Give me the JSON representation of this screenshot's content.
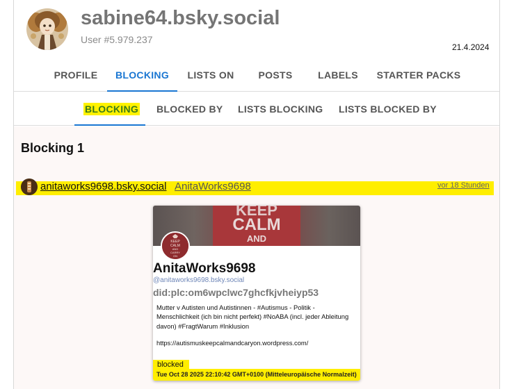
{
  "header": {
    "handle": "sabine64.bsky.social",
    "user_number": "User #5.979.237",
    "date": "21.4.2024"
  },
  "tabs": [
    {
      "label": "PROFILE",
      "active": false
    },
    {
      "label": "BLOCKING",
      "active": true
    },
    {
      "label": "LISTS ON",
      "active": false
    },
    {
      "label": "POSTS",
      "active": false
    },
    {
      "label": "LABELS",
      "active": false
    },
    {
      "label": "STARTER PACKS",
      "active": false
    }
  ],
  "subtabs": [
    {
      "label": "BLOCKING",
      "active": true
    },
    {
      "label": "BLOCKED BY",
      "active": false
    },
    {
      "label": "LISTS BLOCKING",
      "active": false
    },
    {
      "label": "LISTS BLOCKED BY",
      "active": false
    }
  ],
  "section": {
    "title": "Blocking 1"
  },
  "entry": {
    "handle": "anitaworks9698.bsky.social",
    "display_name": "AnitaWorks9698",
    "time_ago": "vor 18 Stunden"
  },
  "card": {
    "banner_lines": [
      "KEEP",
      "CALM",
      "AND"
    ],
    "avatar_lines": [
      "KEEP",
      "CALM",
      "AND",
      "CARRY",
      "ON"
    ],
    "display_name": "AnitaWorks9698",
    "handle": "@anitaworks9698.bsky.social",
    "did": "did:plc:om6wpclwc7ghcfkjvheiyp53",
    "bio": "Mutter v Autisten und Autistinnen - #Autismus - Politik - Menschlichkeit (ich bin nicht perfekt)  #NoABA (incl. jeder Ableitung davon) #FragtWarum #Inklusion",
    "url": "https://autismuskeepcalmandcaryon.wordpress.com/",
    "status": "blocked",
    "blocked_date": "Tue Oct 28 2025 22:10:42 GMT+0100 (Mitteleuropäische Normalzeit)"
  },
  "colors": {
    "accent": "#1976d2",
    "highlight": "#ffee00",
    "title_gray": "#757575"
  }
}
